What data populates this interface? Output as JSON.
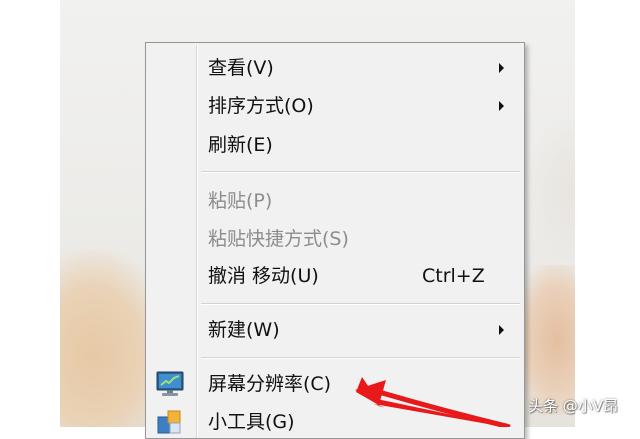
{
  "menu": {
    "items": [
      {
        "label": "查看(V)",
        "submenu": true
      },
      {
        "label": "排序方式(O)",
        "submenu": true
      },
      {
        "label": "刷新(E)"
      },
      {
        "label": "粘贴(P)",
        "disabled": true
      },
      {
        "label": "粘贴快捷方式(S)",
        "disabled": true
      },
      {
        "label": "撤消 移动(U)",
        "shortcut": "Ctrl+Z"
      },
      {
        "label": "新建(W)",
        "submenu": true
      },
      {
        "label": "屏幕分辨率(C)",
        "icon": "monitor-icon"
      },
      {
        "label": "小工具(G)",
        "icon": "gadgets-icon"
      }
    ]
  },
  "annotation": {
    "type": "red-arrow",
    "color": "#e8191b"
  },
  "watermark": {
    "text": "头条 @小V昂"
  }
}
